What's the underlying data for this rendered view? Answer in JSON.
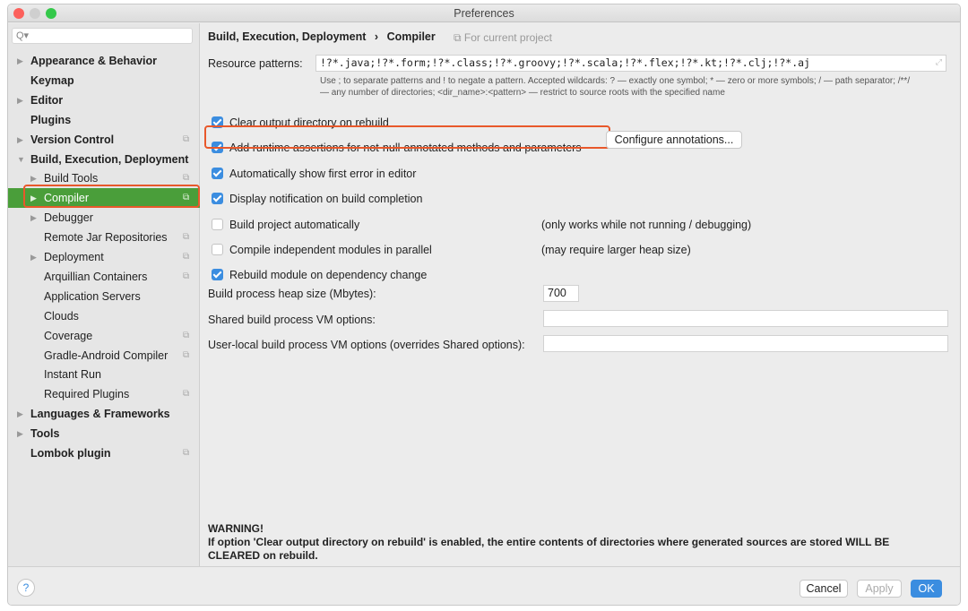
{
  "window": {
    "title": "Preferences"
  },
  "sidebar": {
    "search_placeholder": "Q▾",
    "items": [
      {
        "label": "Appearance & Behavior",
        "level": 0,
        "arrow": "▶",
        "copy": false
      },
      {
        "label": "Keymap",
        "level": 0,
        "arrow": "",
        "copy": false
      },
      {
        "label": "Editor",
        "level": 0,
        "arrow": "▶",
        "copy": false
      },
      {
        "label": "Plugins",
        "level": 0,
        "arrow": "",
        "copy": false
      },
      {
        "label": "Version Control",
        "level": 0,
        "arrow": "▶",
        "copy": true
      },
      {
        "label": "Build, Execution, Deployment",
        "level": 0,
        "arrow": "▼",
        "copy": false
      },
      {
        "label": "Build Tools",
        "level": 1,
        "arrow": "▶",
        "copy": true
      },
      {
        "label": "Compiler",
        "level": 1,
        "arrow": "▶",
        "copy": true,
        "selected": true
      },
      {
        "label": "Debugger",
        "level": 1,
        "arrow": "▶",
        "copy": false
      },
      {
        "label": "Remote Jar Repositories",
        "level": 1,
        "arrow": "",
        "copy": true
      },
      {
        "label": "Deployment",
        "level": 1,
        "arrow": "▶",
        "copy": true
      },
      {
        "label": "Arquillian Containers",
        "level": 1,
        "arrow": "",
        "copy": true
      },
      {
        "label": "Application Servers",
        "level": 1,
        "arrow": "",
        "copy": false
      },
      {
        "label": "Clouds",
        "level": 1,
        "arrow": "",
        "copy": false
      },
      {
        "label": "Coverage",
        "level": 1,
        "arrow": "",
        "copy": true
      },
      {
        "label": "Gradle-Android Compiler",
        "level": 1,
        "arrow": "",
        "copy": true
      },
      {
        "label": "Instant Run",
        "level": 1,
        "arrow": "",
        "copy": false
      },
      {
        "label": "Required Plugins",
        "level": 1,
        "arrow": "",
        "copy": true
      },
      {
        "label": "Languages & Frameworks",
        "level": 0,
        "arrow": "▶",
        "copy": false
      },
      {
        "label": "Tools",
        "level": 0,
        "arrow": "▶",
        "copy": false
      },
      {
        "label": "Lombok plugin",
        "level": 0,
        "arrow": "",
        "copy": true
      }
    ]
  },
  "main": {
    "breadcrumb": [
      "Build, Execution, Deployment",
      "›",
      "Compiler"
    ],
    "scope": "⧉ For current project",
    "resource_label": "Resource patterns:",
    "resource_value": "!?*.java;!?*.form;!?*.class;!?*.groovy;!?*.scala;!?*.flex;!?*.kt;!?*.clj;!?*.aj",
    "resource_hint1": "Use ; to separate patterns and ! to negate a pattern. Accepted wildcards: ? — exactly one symbol; * — zero or more symbols; / — path separator; /**/",
    "resource_hint2": "— any number of directories; <dir_name>:<pattern> — restrict to source roots with the specified name",
    "options": [
      {
        "label": "Clear output directory on rebuild",
        "checked": true,
        "note": ""
      },
      {
        "label": "Add runtime assertions for not-null-annotated methods and parameters",
        "checked": true,
        "note": ""
      },
      {
        "label": "Automatically show first error in editor",
        "checked": true,
        "note": ""
      },
      {
        "label": "Display notification on build completion",
        "checked": true,
        "note": ""
      },
      {
        "label": "Build project automatically",
        "checked": false,
        "note": "(only works while not running / debugging)"
      },
      {
        "label": "Compile independent modules in parallel",
        "checked": false,
        "note": "(may require larger heap size)"
      },
      {
        "label": "Rebuild module on dependency change",
        "checked": true,
        "note": ""
      }
    ],
    "configure_button": "Configure annotations...",
    "heap_label": "Build process heap size (Mbytes):",
    "heap_value": "700",
    "shared_label": "Shared build process VM options:",
    "shared_value": "",
    "local_label": "User-local build process VM options (overrides Shared options):",
    "local_value": "",
    "warning_title": "WARNING!",
    "warning_text": "If option 'Clear output directory on rebuild' is enabled, the entire contents of directories where generated sources are stored WILL BE CLEARED on rebuild."
  },
  "footer": {
    "help": "?",
    "cancel": "Cancel",
    "apply": "Apply",
    "ok": "OK"
  },
  "colors": {
    "accent": "#3b8de0",
    "selection": "#4a9e3a",
    "highlight": "#e8582b"
  }
}
